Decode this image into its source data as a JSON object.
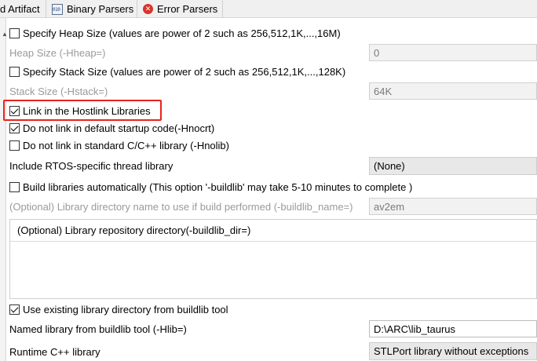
{
  "tabs": [
    {
      "label": "d Artifact",
      "icon": ""
    },
    {
      "label": "Binary Parsers",
      "icon": "binary-parser-icon"
    },
    {
      "label": "Error Parsers",
      "icon": "error-icon"
    }
  ],
  "heap": {
    "checkbox_label": "Specify Heap Size (values are power of 2 such as 256,512,1K,...,16M)",
    "checked": false,
    "field_label": "Heap Size (-Hheap=)",
    "value": "0"
  },
  "stack": {
    "checkbox_label": "Specify Stack Size (values are power of 2 such as 256,512,1K,...,128K)",
    "checked": false,
    "field_label": "Stack Size (-Hstack=)",
    "value": "64K"
  },
  "hostlink": {
    "label": "Link in the Hostlink Libraries",
    "checked": true
  },
  "startup": {
    "label": "Do not link in default startup code(-Hnocrt)",
    "checked": true
  },
  "stdlib": {
    "label": "Do not link in standard C/C++ library (-Hnolib)",
    "checked": false
  },
  "rtos": {
    "label": "Include RTOS-specific thread library",
    "value": "(None)"
  },
  "buildlib": {
    "label": "Build libraries automatically (This option '-buildlib' may take 5-10 minutes to complete )",
    "checked": false,
    "name_label": "(Optional) Library directory name to use if build performed (-buildlib_name=)",
    "name_value": "av2em"
  },
  "repository": {
    "label": "(Optional) Library repository directory(-buildlib_dir=)"
  },
  "existing": {
    "label": "Use existing library directory from buildlib tool",
    "checked": true
  },
  "named": {
    "label": "Named library from buildlib tool (-Hlib=)",
    "value": "D:\\ARC\\lib_taurus"
  },
  "runtime": {
    "label": "Runtime C++ library",
    "value": "STLPort library without exceptions"
  },
  "colors": {
    "highlight": "#e8231d",
    "disabled_text": "#9a9a9a"
  }
}
